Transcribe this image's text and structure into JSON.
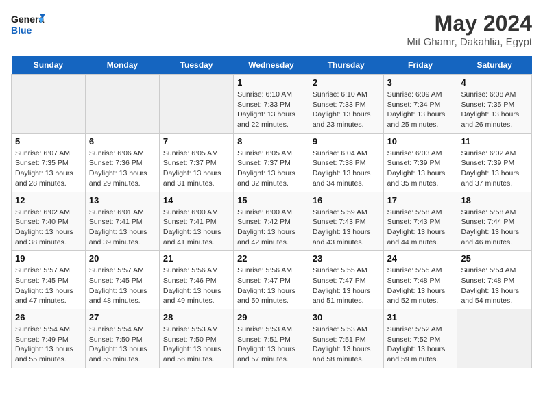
{
  "header": {
    "logo_line1": "General",
    "logo_line2": "Blue",
    "month_year": "May 2024",
    "location": "Mit Ghamr, Dakahlia, Egypt"
  },
  "weekdays": [
    "Sunday",
    "Monday",
    "Tuesday",
    "Wednesday",
    "Thursday",
    "Friday",
    "Saturday"
  ],
  "weeks": [
    [
      {
        "day": "",
        "info": ""
      },
      {
        "day": "",
        "info": ""
      },
      {
        "day": "",
        "info": ""
      },
      {
        "day": "1",
        "info": "Sunrise: 6:10 AM\nSunset: 7:33 PM\nDaylight: 13 hours\nand 22 minutes."
      },
      {
        "day": "2",
        "info": "Sunrise: 6:10 AM\nSunset: 7:33 PM\nDaylight: 13 hours\nand 23 minutes."
      },
      {
        "day": "3",
        "info": "Sunrise: 6:09 AM\nSunset: 7:34 PM\nDaylight: 13 hours\nand 25 minutes."
      },
      {
        "day": "4",
        "info": "Sunrise: 6:08 AM\nSunset: 7:35 PM\nDaylight: 13 hours\nand 26 minutes."
      }
    ],
    [
      {
        "day": "5",
        "info": "Sunrise: 6:07 AM\nSunset: 7:35 PM\nDaylight: 13 hours\nand 28 minutes."
      },
      {
        "day": "6",
        "info": "Sunrise: 6:06 AM\nSunset: 7:36 PM\nDaylight: 13 hours\nand 29 minutes."
      },
      {
        "day": "7",
        "info": "Sunrise: 6:05 AM\nSunset: 7:37 PM\nDaylight: 13 hours\nand 31 minutes."
      },
      {
        "day": "8",
        "info": "Sunrise: 6:05 AM\nSunset: 7:37 PM\nDaylight: 13 hours\nand 32 minutes."
      },
      {
        "day": "9",
        "info": "Sunrise: 6:04 AM\nSunset: 7:38 PM\nDaylight: 13 hours\nand 34 minutes."
      },
      {
        "day": "10",
        "info": "Sunrise: 6:03 AM\nSunset: 7:39 PM\nDaylight: 13 hours\nand 35 minutes."
      },
      {
        "day": "11",
        "info": "Sunrise: 6:02 AM\nSunset: 7:39 PM\nDaylight: 13 hours\nand 37 minutes."
      }
    ],
    [
      {
        "day": "12",
        "info": "Sunrise: 6:02 AM\nSunset: 7:40 PM\nDaylight: 13 hours\nand 38 minutes."
      },
      {
        "day": "13",
        "info": "Sunrise: 6:01 AM\nSunset: 7:41 PM\nDaylight: 13 hours\nand 39 minutes."
      },
      {
        "day": "14",
        "info": "Sunrise: 6:00 AM\nSunset: 7:41 PM\nDaylight: 13 hours\nand 41 minutes."
      },
      {
        "day": "15",
        "info": "Sunrise: 6:00 AM\nSunset: 7:42 PM\nDaylight: 13 hours\nand 42 minutes."
      },
      {
        "day": "16",
        "info": "Sunrise: 5:59 AM\nSunset: 7:43 PM\nDaylight: 13 hours\nand 43 minutes."
      },
      {
        "day": "17",
        "info": "Sunrise: 5:58 AM\nSunset: 7:43 PM\nDaylight: 13 hours\nand 44 minutes."
      },
      {
        "day": "18",
        "info": "Sunrise: 5:58 AM\nSunset: 7:44 PM\nDaylight: 13 hours\nand 46 minutes."
      }
    ],
    [
      {
        "day": "19",
        "info": "Sunrise: 5:57 AM\nSunset: 7:45 PM\nDaylight: 13 hours\nand 47 minutes."
      },
      {
        "day": "20",
        "info": "Sunrise: 5:57 AM\nSunset: 7:45 PM\nDaylight: 13 hours\nand 48 minutes."
      },
      {
        "day": "21",
        "info": "Sunrise: 5:56 AM\nSunset: 7:46 PM\nDaylight: 13 hours\nand 49 minutes."
      },
      {
        "day": "22",
        "info": "Sunrise: 5:56 AM\nSunset: 7:47 PM\nDaylight: 13 hours\nand 50 minutes."
      },
      {
        "day": "23",
        "info": "Sunrise: 5:55 AM\nSunset: 7:47 PM\nDaylight: 13 hours\nand 51 minutes."
      },
      {
        "day": "24",
        "info": "Sunrise: 5:55 AM\nSunset: 7:48 PM\nDaylight: 13 hours\nand 52 minutes."
      },
      {
        "day": "25",
        "info": "Sunrise: 5:54 AM\nSunset: 7:48 PM\nDaylight: 13 hours\nand 54 minutes."
      }
    ],
    [
      {
        "day": "26",
        "info": "Sunrise: 5:54 AM\nSunset: 7:49 PM\nDaylight: 13 hours\nand 55 minutes."
      },
      {
        "day": "27",
        "info": "Sunrise: 5:54 AM\nSunset: 7:50 PM\nDaylight: 13 hours\nand 55 minutes."
      },
      {
        "day": "28",
        "info": "Sunrise: 5:53 AM\nSunset: 7:50 PM\nDaylight: 13 hours\nand 56 minutes."
      },
      {
        "day": "29",
        "info": "Sunrise: 5:53 AM\nSunset: 7:51 PM\nDaylight: 13 hours\nand 57 minutes."
      },
      {
        "day": "30",
        "info": "Sunrise: 5:53 AM\nSunset: 7:51 PM\nDaylight: 13 hours\nand 58 minutes."
      },
      {
        "day": "31",
        "info": "Sunrise: 5:52 AM\nSunset: 7:52 PM\nDaylight: 13 hours\nand 59 minutes."
      },
      {
        "day": "",
        "info": ""
      }
    ]
  ]
}
